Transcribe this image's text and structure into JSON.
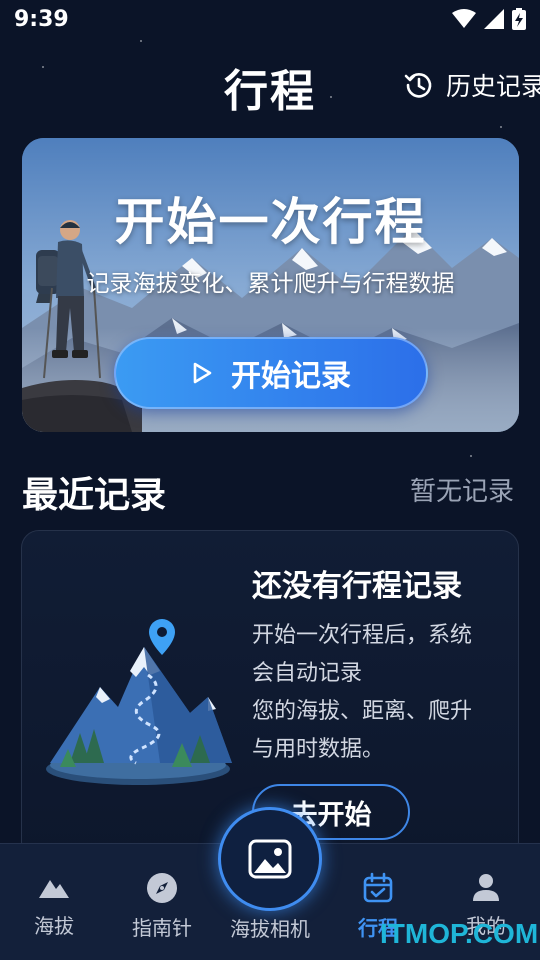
{
  "status_bar": {
    "time": "9:39",
    "icons": [
      "wifi-icon",
      "signal-icon",
      "battery-charging-icon"
    ]
  },
  "header": {
    "title": "行程",
    "history_label": "历史记录"
  },
  "hero": {
    "title": "开始一次行程",
    "subtitle": "记录海拔变化、累计爬升与行程数据",
    "button_label": "开始记录"
  },
  "recent": {
    "section_title": "最近记录",
    "status": "暂无记录"
  },
  "empty_state": {
    "title": "还没有行程记录",
    "desc_line1": "开始一次行程后，系统",
    "desc_line2": "会自动记录",
    "desc_line3": "您的海拔、距离、爬升",
    "desc_line4": "与用时数据。",
    "button_label": "去开始"
  },
  "bottom_nav": {
    "items": [
      {
        "label": "海拔",
        "icon": "mountain-icon",
        "active": false
      },
      {
        "label": "指南针",
        "icon": "compass-icon",
        "active": false
      },
      {
        "label": "海拔相机",
        "icon": "image-icon",
        "active": false
      },
      {
        "label": "行程",
        "icon": "calendar-icon",
        "active": true
      },
      {
        "label": "我的",
        "icon": "person-icon",
        "active": false
      }
    ]
  },
  "watermark": "ITMOP.COM",
  "colors": {
    "background": "#0b1428",
    "accent": "#3f93f3",
    "button_gradient_start": "#3b9bf3",
    "button_gradient_end": "#2c6fe9"
  }
}
